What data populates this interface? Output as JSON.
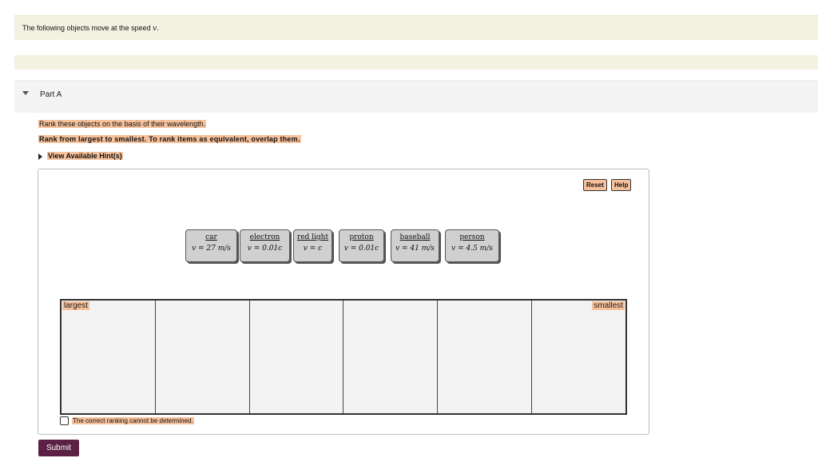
{
  "intro": {
    "text": "The following objects move at the speed ",
    "var": "v",
    "end": "."
  },
  "part": {
    "label": "Part A"
  },
  "instructions": {
    "line1": "Rank these objects on the basis of their wavelength.",
    "line2": "Rank from largest to smallest. To rank items as equivalent, overlap them.",
    "hint": "View Available Hint(s)"
  },
  "toolbar": {
    "reset": "Reset",
    "help": "Help"
  },
  "tiles": [
    {
      "name": "car",
      "speed": "v = 27 m/s"
    },
    {
      "name": "electron",
      "speed": "v = 0.01c"
    },
    {
      "name": "red light",
      "speed": "v = c"
    },
    {
      "name": "proton",
      "speed": "v = 0.01c"
    },
    {
      "name": "baseball",
      "speed": "v = 41 m/s"
    },
    {
      "name": "person",
      "speed": "v = 4.5 m/s"
    }
  ],
  "ranking": {
    "largest": "largest",
    "smallest": "smallest"
  },
  "cannot_determine": "The correct ranking cannot be determined.",
  "submit": "Submit",
  "colors": {
    "highlight": "#f6c19b",
    "submit_bg": "#5b2144",
    "intro_bg": "#f3f2e2"
  }
}
